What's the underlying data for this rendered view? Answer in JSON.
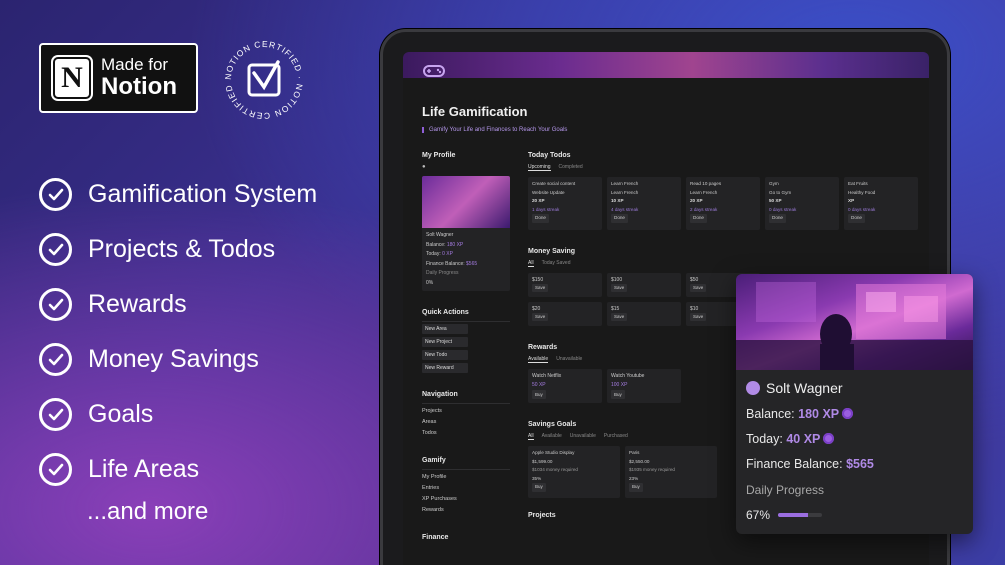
{
  "badge": {
    "line1": "Made for",
    "line2": "Notion",
    "logo_letter": "N"
  },
  "certified": {
    "text": "NOTION CERTIFIED · NOTION CERTIFIED ·"
  },
  "features": [
    "Gamification System",
    "Projects & Todos",
    "Rewards",
    "Money Savings",
    "Goals",
    "Life Areas"
  ],
  "more": "...and more",
  "notion_page": {
    "title": "Life Gamification",
    "subtitle": "Gamify Your Life and Finances to Reach Your Goals",
    "profile": {
      "heading": "My Profile",
      "name": "Solt Wagner",
      "balance_label": "Balance:",
      "balance_value": "180 XP",
      "today_label": "Today:",
      "today_value": "0 XP",
      "finance_label": "Finance Balance:",
      "finance_value": "$565",
      "daily_label": "Daily Progress",
      "daily_value": "0%"
    },
    "quick_actions": {
      "heading": "Quick Actions",
      "items": [
        "New Area",
        "New Project",
        "New Todo",
        "New Reward"
      ]
    },
    "navigation": {
      "heading": "Navigation",
      "items": [
        "Projects",
        "Areas",
        "Todos"
      ]
    },
    "gamify": {
      "heading": "Gamify",
      "items": [
        "My Profile",
        "Entries",
        "XP Purchases",
        "Rewards"
      ]
    },
    "finance": {
      "heading": "Finance"
    },
    "todos": {
      "heading": "Today Todos",
      "tabs": [
        "Upcoming",
        "Completed"
      ],
      "cards": [
        {
          "title": "Create social content",
          "sub": "Website Update",
          "xp": "20 XP",
          "streak": "1 days streak",
          "btn": "Done"
        },
        {
          "title": "Learn French",
          "sub": "Learn French",
          "xp": "10 XP",
          "streak": "4 days streak",
          "btn": "Done"
        },
        {
          "title": "Read 10 pages",
          "sub": "Learn French",
          "xp": "20 XP",
          "streak": "2 days streak",
          "btn": "Done"
        },
        {
          "title": "Gym",
          "sub": "Go to Gym",
          "xp": "50 XP",
          "streak": "0 days streak",
          "btn": "Done"
        },
        {
          "title": "Eat Fruits",
          "sub": "Healthy Food",
          "xp": "XP",
          "streak": "0 days streak",
          "btn": "Done"
        }
      ]
    },
    "money": {
      "heading": "Money Saving",
      "tabs": [
        "All",
        "Today Saved"
      ],
      "cards": [
        {
          "amount": "$150",
          "btn": "Save"
        },
        {
          "amount": "$100",
          "btn": "Save"
        },
        {
          "amount": "$50",
          "btn": "Save"
        },
        {
          "amount": "$20",
          "btn": "Save"
        },
        {
          "amount": "$15",
          "btn": "Save"
        },
        {
          "amount": "$10",
          "btn": "Save"
        }
      ]
    },
    "rewards": {
      "heading": "Rewards",
      "tabs": [
        "Available",
        "Unavailable"
      ],
      "cards": [
        {
          "title": "Watch Netflix",
          "xp": "50 XP",
          "btn": "Buy"
        },
        {
          "title": "Watch Youtube",
          "xp": "100 XP",
          "btn": "Buy"
        }
      ]
    },
    "savings_goals": {
      "heading": "Savings Goals",
      "tabs": [
        "All",
        "Available",
        "Unavailable",
        "Purchased"
      ],
      "cards": [
        {
          "title": "Apple Studio Display",
          "price": "$1,599.00",
          "req": "$1034 money required",
          "pct": "35%",
          "btn": "Buy"
        },
        {
          "title": "Paris",
          "price": "$2,550.00",
          "req": "$1935 money required",
          "pct": "23%",
          "btn": "Buy"
        }
      ]
    },
    "projects": {
      "heading": "Projects"
    }
  },
  "float_card": {
    "name": "Solt Wagner",
    "balance_label": "Balance:",
    "balance_value": "180 XP",
    "today_label": "Today:",
    "today_value": "40 XP",
    "finance_label": "Finance Balance:",
    "finance_value": "$565",
    "daily_label": "Daily Progress",
    "daily_value": "67%",
    "daily_fraction": 0.67
  },
  "colors": {
    "accent": "#a47be0",
    "card": "#232325",
    "page": "#191919"
  }
}
